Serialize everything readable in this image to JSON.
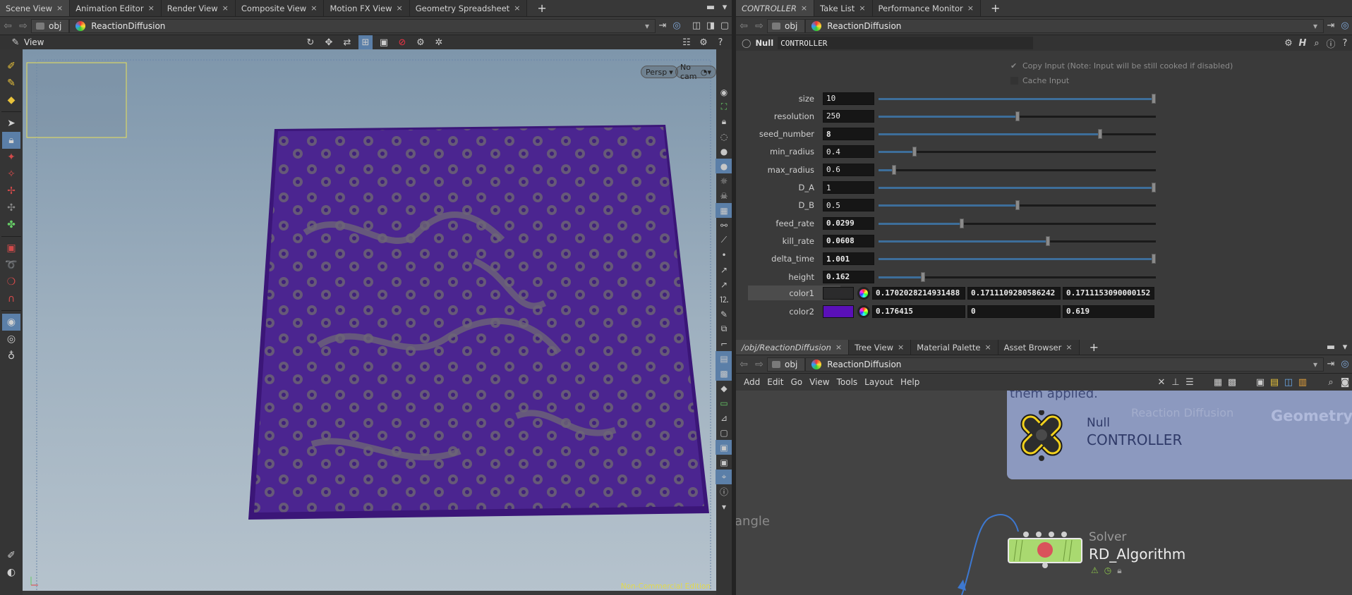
{
  "left_tabs": [
    {
      "label": "Scene View",
      "active": true
    },
    {
      "label": "Animation Editor"
    },
    {
      "label": "Render View"
    },
    {
      "label": "Composite View"
    },
    {
      "label": "Motion FX View"
    },
    {
      "label": "Geometry Spreadsheet"
    }
  ],
  "right_top_tabs": [
    {
      "label": "CONTROLLER",
      "active": true
    },
    {
      "label": "Take List"
    },
    {
      "label": "Performance Monitor"
    }
  ],
  "right_bottom_tabs": [
    {
      "label": "/obj/ReactionDiffusion",
      "active": true
    },
    {
      "label": "Tree View"
    },
    {
      "label": "Material Palette"
    },
    {
      "label": "Asset Browser"
    }
  ],
  "left_path": {
    "context": "obj",
    "node": "ReactionDiffusion"
  },
  "right_top_path": {
    "context": "obj",
    "node": "ReactionDiffusion"
  },
  "right_bottom_path": {
    "context": "obj",
    "node": "ReactionDiffusion"
  },
  "viewer": {
    "title": "View",
    "persp_label": "Persp",
    "cam_label": "No cam",
    "watermark": "Non-Commercial Edition",
    "surface_color": "#4a1f8f"
  },
  "param_header": {
    "node_type": "Null",
    "node_name": "CONTROLLER"
  },
  "checkboxes": [
    {
      "label": "Copy Input (Note: Input will be still cooked if disabled)",
      "checked": true
    },
    {
      "label": "Cache Input",
      "checked": false
    }
  ],
  "params": [
    {
      "label": "size",
      "value": "10",
      "bold": false,
      "fraction": 1.0
    },
    {
      "label": "resolution",
      "value": "250",
      "bold": false,
      "fraction": 0.5
    },
    {
      "label": "seed_number",
      "value": "8",
      "bold": true,
      "fraction": 0.8
    },
    {
      "label": "min_radius",
      "value": "0.4",
      "bold": false,
      "fraction": 0.13
    },
    {
      "label": "max_radius",
      "value": "0.6",
      "bold": false,
      "fraction": 0.055
    },
    {
      "label": "D_A",
      "value": "1",
      "bold": false,
      "fraction": 1.0
    },
    {
      "label": "D_B",
      "value": "0.5",
      "bold": false,
      "fraction": 0.5
    },
    {
      "label": "feed_rate",
      "value": "0.0299",
      "bold": true,
      "fraction": 0.3
    },
    {
      "label": "kill_rate",
      "value": "0.0608",
      "bold": true,
      "fraction": 0.61
    },
    {
      "label": "delta_time",
      "value": "1.001",
      "bold": true,
      "fraction": 1.0
    },
    {
      "label": "height",
      "value": "0.162",
      "bold": true,
      "fraction": 0.16
    }
  ],
  "colors": [
    {
      "label": "color1",
      "swatch": "#2b2b2c",
      "values": [
        "0.1702028214931488",
        "0.1711109280586242",
        "0.1711153090000152"
      ],
      "highlight": true
    },
    {
      "label": "color2",
      "swatch": "#5a10b8",
      "values": [
        "0.176415",
        "0",
        "0.619"
      ],
      "highlight": false
    }
  ],
  "network_menu": [
    "Add",
    "Edit",
    "Go",
    "View",
    "Tools",
    "Layout",
    "Help"
  ],
  "network": {
    "sticky_text": "them applied.",
    "sticky_faded": "Reaction Diffusion",
    "geometry_label": "Geometry",
    "node1_type": "Null",
    "node1_name": "CONTROLLER",
    "node2_type": "Solver",
    "node2_name": "RD_Algorithm",
    "side_label": "angle"
  }
}
